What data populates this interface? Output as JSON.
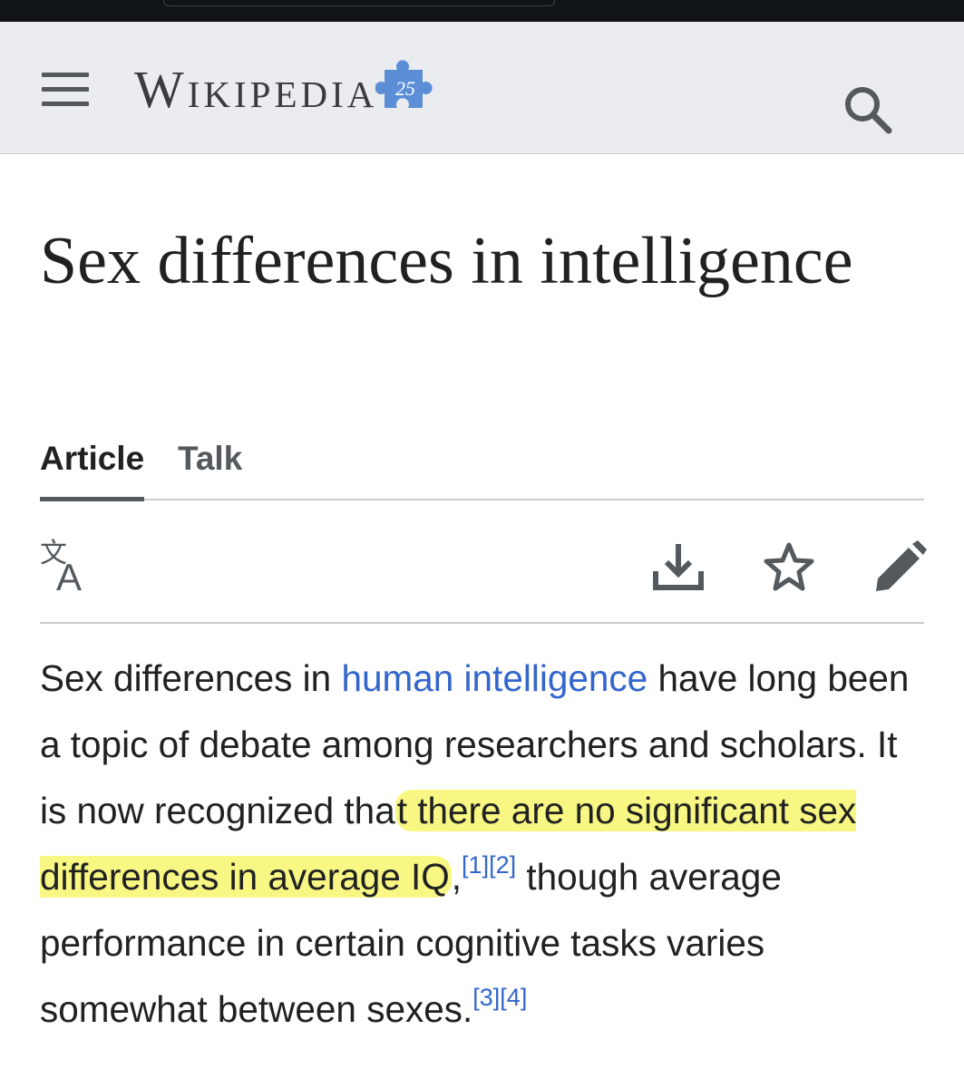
{
  "header": {
    "wordmark": "Wikipedia",
    "logo_badge": "25",
    "menu_icon": "hamburger-menu-icon",
    "search_icon": "search-icon"
  },
  "article": {
    "title": "Sex differences in intelligence",
    "tabs": [
      {
        "label": "Article",
        "selected": true
      },
      {
        "label": "Talk",
        "selected": false
      }
    ],
    "toolbar": {
      "language_icon": "language-icon",
      "download_icon": "download-icon",
      "watch_icon": "star-icon",
      "edit_icon": "pencil-icon"
    },
    "lead": {
      "t1": "Sex differences in ",
      "link": "human intelligence",
      "t2": " have long been a topic of debate among researchers and scholars. It is now recognized tha",
      "highlighted": "t there are no significant sex differences in average IQ",
      "t3": ",",
      "ref1": "[1]",
      "ref2": "[2]",
      "t4": " though average performance in certain cognitive tasks varies somewhat between sexes.",
      "ref3": "[3]",
      "ref4": "[4]"
    }
  },
  "colors": {
    "header_bg": "#eaecf0",
    "link": "#3366cc",
    "highlight": "#f4f340",
    "text": "#202122"
  }
}
